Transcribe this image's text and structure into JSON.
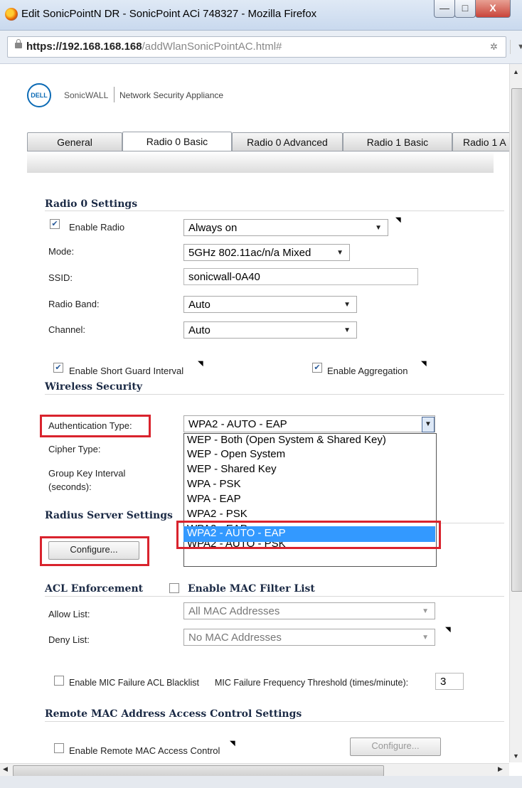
{
  "window": {
    "title": "Edit SonicPointN DR - SonicPoint ACi 748327 - Mozilla Firefox"
  },
  "urlbar": {
    "host": "https://192.168.168.168",
    "path": "/addWlanSonicPointAC.html#"
  },
  "brand": {
    "logo": "DELL",
    "product": "SonicWALL",
    "subtitle": "Network Security Appliance"
  },
  "tabs": [
    "General",
    "Radio 0 Basic",
    "Radio 0 Advanced",
    "Radio 1 Basic",
    "Radio 1 A"
  ],
  "radio_settings": {
    "heading": "Radio 0 Settings",
    "enable_radio_label": "Enable Radio",
    "enable_radio_value": "Always on",
    "mode_label": "Mode:",
    "mode_value": "5GHz 802.11ac/n/a Mixed",
    "ssid_label": "SSID:",
    "ssid_value": "sonicwall-0A40",
    "band_label": "Radio Band:",
    "band_value": "Auto",
    "channel_label": "Channel:",
    "channel_value": "Auto",
    "short_guard_label": "Enable Short Guard Interval",
    "aggregation_label": "Enable Aggregation"
  },
  "wireless_security": {
    "heading": "Wireless Security",
    "auth_label": "Authentication Type:",
    "auth_value": "WPA2 - AUTO - EAP",
    "cipher_label": "Cipher Type:",
    "group_key_label_1": "Group Key Interval",
    "group_key_label_2": "(seconds):",
    "options": [
      "WEP - Both (Open System & Shared Key)",
      "WEP - Open System",
      "WEP - Shared Key",
      "WPA - PSK",
      "WPA - EAP",
      "WPA2 - PSK",
      "WPA2 - EAP",
      "WPA2 - AUTO - PSK",
      "WPA2 - AUTO - EAP"
    ]
  },
  "radius": {
    "heading": "Radius Server Settings",
    "configure_label": "Configure..."
  },
  "acl": {
    "heading": "ACL Enforcement",
    "mac_filter_label": "Enable MAC Filter List",
    "allow_label": "Allow List:",
    "allow_value": "All MAC Addresses",
    "deny_label": "Deny List:",
    "deny_value": "No MAC Addresses",
    "mic_blacklist_label": "Enable MIC Failure ACL Blacklist",
    "mic_threshold_label": "MIC Failure Frequency Threshold (times/minute):",
    "mic_threshold_value": "3"
  },
  "remote_mac": {
    "heading": "Remote MAC Address Access Control Settings",
    "enable_label": "Enable Remote MAC Access Control",
    "configure_label": "Configure..."
  }
}
